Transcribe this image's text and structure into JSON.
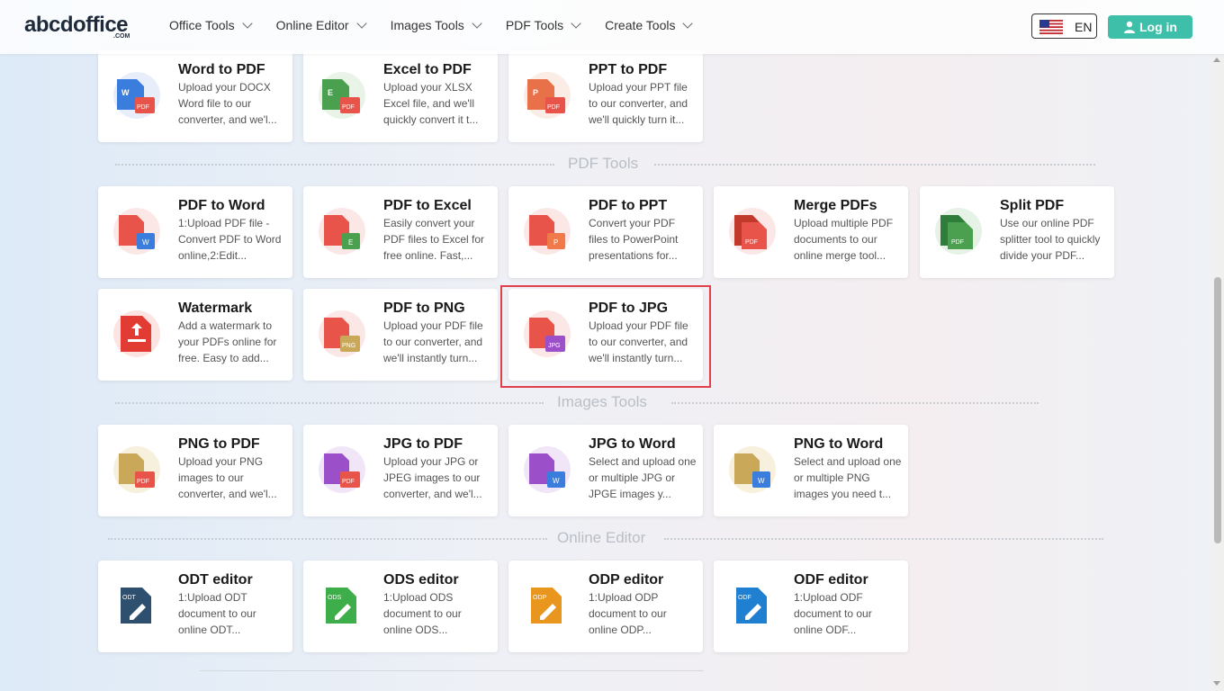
{
  "header": {
    "logo": "abcdoffice",
    "logo_sub": ".COM",
    "nav": [
      "Office Tools",
      "Online Editor",
      "Images Tools",
      "PDF Tools",
      "Create Tools"
    ],
    "lang": "EN",
    "login": "Log in"
  },
  "sections": {
    "pdf_tools": "PDF Tools",
    "images_tools": "Images Tools",
    "online_editor": "Online Editor"
  },
  "cards": {
    "word_to_pdf": {
      "title": "Word to PDF",
      "desc": "Upload your DOCX Word file to our converter, and we'l..."
    },
    "excel_to_pdf": {
      "title": "Excel to PDF",
      "desc": "Upload your XLSX Excel file, and we'll quickly convert it t..."
    },
    "ppt_to_pdf": {
      "title": "PPT to PDF",
      "desc": "Upload your PPT file to our converter, and we'll quickly turn it..."
    },
    "pdf_to_word": {
      "title": "PDF to Word",
      "desc": "1:Upload PDF file - Convert PDF to Word online,2:Edit..."
    },
    "pdf_to_excel": {
      "title": "PDF to Excel",
      "desc": "Easily convert your PDF files to Excel for free online. Fast,..."
    },
    "pdf_to_ppt": {
      "title": "PDF to PPT",
      "desc": "Convert your PDF files to PowerPoint presentations for..."
    },
    "merge_pdfs": {
      "title": "Merge PDFs",
      "desc": "Upload multiple PDF documents to our online merge tool..."
    },
    "split_pdf": {
      "title": "Split PDF",
      "desc": "Use our online PDF splitter tool to quickly divide your PDF..."
    },
    "watermark": {
      "title": "Watermark",
      "desc": "Add a watermark to your PDFs online for free. Easy to add..."
    },
    "pdf_to_png": {
      "title": "PDF to PNG",
      "desc": "Upload your PDF file to our converter, and we'll instantly turn..."
    },
    "pdf_to_jpg": {
      "title": "PDF to JPG",
      "desc": "Upload your PDF file to our converter, and we'll instantly turn..."
    },
    "png_to_pdf": {
      "title": "PNG to PDF",
      "desc": "Upload your PNG images to our converter, and we'l..."
    },
    "jpg_to_pdf": {
      "title": "JPG to PDF",
      "desc": "Upload your JPG or JPEG images to our converter, and we'l..."
    },
    "jpg_to_word": {
      "title": "JPG to Word",
      "desc": "Select and upload one or multiple JPG or JPGE images y..."
    },
    "png_to_word": {
      "title": "PNG to Word",
      "desc": "Select and upload one or multiple PNG images you need t..."
    },
    "odt_editor": {
      "title": "ODT editor",
      "desc": "1:Upload ODT document to our online ODT..."
    },
    "ods_editor": {
      "title": "ODS editor",
      "desc": "1:Upload ODS document to our online ODS..."
    },
    "odp_editor": {
      "title": "ODP editor",
      "desc": "1:Upload ODP document to our online ODP..."
    },
    "odf_editor": {
      "title": "ODF editor",
      "desc": "1:Upload ODF document to our online ODF..."
    }
  },
  "icons": {
    "word_to_pdf": {
      "badge": "W",
      "sub": "PDF"
    },
    "excel_to_pdf": {
      "badge": "E",
      "sub": "PDF"
    },
    "ppt_to_pdf": {
      "badge": "P",
      "sub": "PDF"
    },
    "pdf_to_word": {
      "sub": "W"
    },
    "pdf_to_excel": {
      "sub": "E"
    },
    "pdf_to_ppt": {
      "sub": "P"
    },
    "merge_pdfs": {
      "sub": "PDF"
    },
    "split_pdf": {
      "sub": "PDF"
    },
    "pdf_to_png": {
      "sub": "PNG"
    },
    "pdf_to_jpg": {
      "sub": "JPG"
    },
    "png_to_pdf": {
      "sub": "PDF"
    },
    "jpg_to_pdf": {
      "sub": "PDF"
    },
    "jpg_to_word": {
      "sub": "W"
    },
    "png_to_word": {
      "sub": "W"
    },
    "odt_editor": {
      "badge": "ODT"
    },
    "ods_editor": {
      "badge": "ODS"
    },
    "odp_editor": {
      "badge": "ODP"
    },
    "odf_editor": {
      "badge": "ODF"
    }
  },
  "colors": {
    "accent": "#3dbfa9",
    "highlight": "#e0404a",
    "pdf_red": "#e8544a",
    "word_blue": "#3b7ddd",
    "excel_green": "#3a9a47"
  }
}
